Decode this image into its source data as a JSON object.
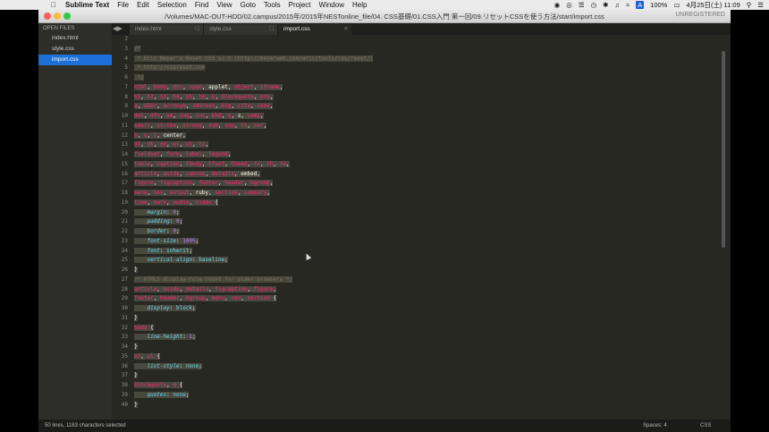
{
  "menubar": {
    "apple_icon": "apple-icon",
    "app_name": "Sublime Text",
    "items": [
      "File",
      "Edit",
      "Selection",
      "Find",
      "View",
      "Goto",
      "Tools",
      "Project",
      "Window",
      "Help"
    ],
    "battery": "100%",
    "clock": "4月25日(土)  11:09",
    "status_icons": [
      "record-icon",
      "eye-icon",
      "menu-icon",
      "clock-icon",
      "bluetooth-icon",
      "volume-icon",
      "wifi-icon",
      "input-method-icon",
      "search-icon",
      "list-icon"
    ]
  },
  "window": {
    "title": "/Volumes/MAC-OUT-HDD/02.campus/2015年/2015年NESTonline_file/04. CSS基礎/01.CSS入門 第一回/09.リセットCSSを使う方法/start/import.css",
    "unregistered": "UNREGISTERED"
  },
  "sidebar": {
    "header": "OPEN FILES",
    "files": [
      {
        "name": "index.html",
        "active": false
      },
      {
        "name": "style.css",
        "active": false
      },
      {
        "name": "import.css",
        "active": true
      }
    ]
  },
  "tabs": [
    {
      "label": "index.html",
      "active": false
    },
    {
      "label": "style.css",
      "active": false
    },
    {
      "label": "import.css",
      "active": true
    }
  ],
  "editor": {
    "line_numbers": [
      "2",
      "3",
      "4",
      "5",
      "6",
      "7",
      "8",
      "9",
      "10",
      "11",
      "12",
      "13",
      "14",
      "15",
      "16",
      "17",
      "18",
      "19",
      "20",
      "21",
      "22",
      "23",
      "24",
      "25",
      "26",
      "27",
      "28",
      "29",
      "30",
      "31",
      "32",
      "33",
      "34",
      "35",
      "36",
      "37",
      "38",
      "39",
      "40"
    ],
    "lines": [
      [],
      [
        [
          "/*",
          "com"
        ]
      ],
      [
        [
          " * Eric Meyer's Reset CSS v2.0 (http://meyerweb.com/eric/tools/css/reset/)",
          "com"
        ]
      ],
      [
        [
          " * http://cssreset.com",
          "com"
        ]
      ],
      [
        [
          " */",
          "com"
        ]
      ],
      [
        [
          "html",
          "tag"
        ],
        [
          ", ",
          "w"
        ],
        [
          "body",
          "tag"
        ],
        [
          ", ",
          "w"
        ],
        [
          "div",
          "tag"
        ],
        [
          ", ",
          "w"
        ],
        [
          "span",
          "tag"
        ],
        [
          ", applet, ",
          "w"
        ],
        [
          "object",
          "tag"
        ],
        [
          ", ",
          "w"
        ],
        [
          "iframe",
          "tag"
        ],
        [
          ",",
          "w"
        ]
      ],
      [
        [
          "h1",
          "tag"
        ],
        [
          ", ",
          "w"
        ],
        [
          "h2",
          "tag"
        ],
        [
          ", ",
          "w"
        ],
        [
          "h3",
          "tag"
        ],
        [
          ", ",
          "w"
        ],
        [
          "h4",
          "tag"
        ],
        [
          ", ",
          "w"
        ],
        [
          "h5",
          "tag"
        ],
        [
          ", ",
          "w"
        ],
        [
          "h6",
          "tag"
        ],
        [
          ", ",
          "w"
        ],
        [
          "p",
          "tag"
        ],
        [
          ", ",
          "w"
        ],
        [
          "blockquote",
          "tag"
        ],
        [
          ", ",
          "w"
        ],
        [
          "pre",
          "tag"
        ],
        [
          ",",
          "w"
        ]
      ],
      [
        [
          "a",
          "tag"
        ],
        [
          ", ",
          "w"
        ],
        [
          "abbr",
          "tag"
        ],
        [
          ", ",
          "w"
        ],
        [
          "acronym",
          "tag"
        ],
        [
          ", ",
          "w"
        ],
        [
          "address",
          "tag"
        ],
        [
          ", ",
          "w"
        ],
        [
          "big",
          "tag"
        ],
        [
          ", ",
          "w"
        ],
        [
          "cite",
          "tag"
        ],
        [
          ", ",
          "w"
        ],
        [
          "code",
          "tag"
        ],
        [
          ",",
          "w"
        ]
      ],
      [
        [
          "del",
          "tag"
        ],
        [
          ", ",
          "w"
        ],
        [
          "dfn",
          "tag"
        ],
        [
          ", ",
          "w"
        ],
        [
          "em",
          "tag"
        ],
        [
          ", ",
          "w"
        ],
        [
          "img",
          "tag"
        ],
        [
          ", ",
          "w"
        ],
        [
          "ins",
          "tag"
        ],
        [
          ", ",
          "w"
        ],
        [
          "kbd",
          "tag"
        ],
        [
          ", ",
          "w"
        ],
        [
          "q",
          "tag"
        ],
        [
          ", s, ",
          "w"
        ],
        [
          "samp",
          "tag"
        ],
        [
          ",",
          "w"
        ]
      ],
      [
        [
          "small",
          "tag"
        ],
        [
          ", ",
          "w"
        ],
        [
          "strike",
          "tag"
        ],
        [
          ", ",
          "w"
        ],
        [
          "strong",
          "tag"
        ],
        [
          ", ",
          "w"
        ],
        [
          "sub",
          "tag"
        ],
        [
          ", ",
          "w"
        ],
        [
          "sup",
          "tag"
        ],
        [
          ", ",
          "w"
        ],
        [
          "tt",
          "tag"
        ],
        [
          ", ",
          "w"
        ],
        [
          "var",
          "tag"
        ],
        [
          ",",
          "w"
        ]
      ],
      [
        [
          "b",
          "tag"
        ],
        [
          ", ",
          "w"
        ],
        [
          "u",
          "tag"
        ],
        [
          ", ",
          "w"
        ],
        [
          "i",
          "tag"
        ],
        [
          ", center,",
          "w"
        ]
      ],
      [
        [
          "dl",
          "tag"
        ],
        [
          ", ",
          "w"
        ],
        [
          "dt",
          "tag"
        ],
        [
          ", ",
          "w"
        ],
        [
          "dd",
          "tag"
        ],
        [
          ", ",
          "w"
        ],
        [
          "ol",
          "tag"
        ],
        [
          ", ",
          "w"
        ],
        [
          "ul",
          "tag"
        ],
        [
          ", ",
          "w"
        ],
        [
          "li",
          "tag"
        ],
        [
          ",",
          "w"
        ]
      ],
      [
        [
          "fieldset",
          "tag"
        ],
        [
          ", ",
          "w"
        ],
        [
          "form",
          "tag"
        ],
        [
          ", ",
          "w"
        ],
        [
          "label",
          "tag"
        ],
        [
          ", ",
          "w"
        ],
        [
          "legend",
          "tag"
        ],
        [
          ",",
          "w"
        ]
      ],
      [
        [
          "table",
          "tag"
        ],
        [
          ", ",
          "w"
        ],
        [
          "caption",
          "tag"
        ],
        [
          ", ",
          "w"
        ],
        [
          "tbody",
          "tag"
        ],
        [
          ", ",
          "w"
        ],
        [
          "tfoot",
          "tag"
        ],
        [
          ", ",
          "w"
        ],
        [
          "thead",
          "tag"
        ],
        [
          ", ",
          "w"
        ],
        [
          "tr",
          "tag"
        ],
        [
          ", ",
          "w"
        ],
        [
          "th",
          "tag"
        ],
        [
          ", ",
          "w"
        ],
        [
          "td",
          "tag"
        ],
        [
          ",",
          "w"
        ]
      ],
      [
        [
          "article",
          "tag"
        ],
        [
          ", ",
          "w"
        ],
        [
          "aside",
          "tag"
        ],
        [
          ", ",
          "w"
        ],
        [
          "canvas",
          "tag"
        ],
        [
          ", ",
          "w"
        ],
        [
          "details",
          "tag"
        ],
        [
          ", embed,",
          "w"
        ]
      ],
      [
        [
          "figure",
          "tag"
        ],
        [
          ", ",
          "w"
        ],
        [
          "figcaption",
          "tag"
        ],
        [
          ", ",
          "w"
        ],
        [
          "footer",
          "tag"
        ],
        [
          ", ",
          "w"
        ],
        [
          "header",
          "tag"
        ],
        [
          ", ",
          "w"
        ],
        [
          "hgroup",
          "tag"
        ],
        [
          ",",
          "w"
        ]
      ],
      [
        [
          "menu",
          "tag"
        ],
        [
          ", ",
          "w"
        ],
        [
          "nav",
          "tag"
        ],
        [
          ", ",
          "w"
        ],
        [
          "output",
          "tag"
        ],
        [
          ", ruby, ",
          "w"
        ],
        [
          "section",
          "tag"
        ],
        [
          ", ",
          "w"
        ],
        [
          "summary",
          "tag"
        ],
        [
          ",",
          "w"
        ]
      ],
      [
        [
          "time",
          "tag"
        ],
        [
          ", ",
          "w"
        ],
        [
          "mark",
          "tag"
        ],
        [
          ", ",
          "w"
        ],
        [
          "audio",
          "tag"
        ],
        [
          ", ",
          "w"
        ],
        [
          "video",
          "tag"
        ],
        [
          " {",
          "w"
        ]
      ],
      [
        [
          "····",
          "ind"
        ],
        [
          "margin",
          "prop"
        ],
        [
          ": ",
          "w"
        ],
        [
          "0",
          "num"
        ],
        [
          ";",
          "w"
        ]
      ],
      [
        [
          "····",
          "ind"
        ],
        [
          "padding",
          "prop"
        ],
        [
          ": ",
          "w"
        ],
        [
          "0",
          "num"
        ],
        [
          ";",
          "w"
        ]
      ],
      [
        [
          "····",
          "ind"
        ],
        [
          "border",
          "prop"
        ],
        [
          ": ",
          "w"
        ],
        [
          "0",
          "num"
        ],
        [
          ";",
          "w"
        ]
      ],
      [
        [
          "····",
          "ind"
        ],
        [
          "font-size",
          "prop"
        ],
        [
          ": ",
          "w"
        ],
        [
          "100%",
          "num"
        ],
        [
          ";",
          "w"
        ]
      ],
      [
        [
          "····",
          "ind"
        ],
        [
          "font",
          "prop"
        ],
        [
          ": ",
          "w"
        ],
        [
          "inherit",
          "val"
        ],
        [
          ";",
          "w"
        ]
      ],
      [
        [
          "····",
          "ind"
        ],
        [
          "vertical-align",
          "prop"
        ],
        [
          ": ",
          "w"
        ],
        [
          "baseline",
          "val"
        ],
        [
          ";",
          "w"
        ]
      ],
      [
        [
          "}",
          "w"
        ]
      ],
      [
        [
          "/* HTML5 display-role reset for older browsers */",
          "com"
        ]
      ],
      [
        [
          "article",
          "tag"
        ],
        [
          ", ",
          "w"
        ],
        [
          "aside",
          "tag"
        ],
        [
          ", ",
          "w"
        ],
        [
          "details",
          "tag"
        ],
        [
          ", ",
          "w"
        ],
        [
          "figcaption",
          "tag"
        ],
        [
          ", ",
          "w"
        ],
        [
          "figure",
          "tag"
        ],
        [
          ",",
          "w"
        ]
      ],
      [
        [
          "footer",
          "tag"
        ],
        [
          ", ",
          "w"
        ],
        [
          "header",
          "tag"
        ],
        [
          ", ",
          "w"
        ],
        [
          "hgroup",
          "tag"
        ],
        [
          ", ",
          "w"
        ],
        [
          "menu",
          "tag"
        ],
        [
          ", ",
          "w"
        ],
        [
          "nav",
          "tag"
        ],
        [
          ", ",
          "w"
        ],
        [
          "section",
          "tag"
        ],
        [
          " {",
          "w"
        ]
      ],
      [
        [
          "····",
          "ind"
        ],
        [
          "display",
          "prop"
        ],
        [
          ": ",
          "w"
        ],
        [
          "block",
          "val"
        ],
        [
          ";",
          "w"
        ]
      ],
      [
        [
          "}",
          "w"
        ]
      ],
      [
        [
          "body",
          "tag"
        ],
        [
          " {",
          "w"
        ]
      ],
      [
        [
          "····",
          "ind"
        ],
        [
          "line-height",
          "prop"
        ],
        [
          ": ",
          "w"
        ],
        [
          "1",
          "num"
        ],
        [
          ";",
          "w"
        ]
      ],
      [
        [
          "}",
          "w"
        ]
      ],
      [
        [
          "ol",
          "tag"
        ],
        [
          ", ",
          "w"
        ],
        [
          "ul",
          "tag"
        ],
        [
          " {",
          "w"
        ]
      ],
      [
        [
          "····",
          "ind"
        ],
        [
          "list-style",
          "prop"
        ],
        [
          ": ",
          "w"
        ],
        [
          "none",
          "val"
        ],
        [
          ";",
          "w"
        ]
      ],
      [
        [
          "}",
          "w"
        ]
      ],
      [
        [
          "blockquote",
          "tag"
        ],
        [
          ", ",
          "w"
        ],
        [
          "q",
          "tag"
        ],
        [
          " {",
          "w"
        ]
      ],
      [
        [
          "····",
          "ind"
        ],
        [
          "quotes",
          "prop"
        ],
        [
          ": ",
          "w"
        ],
        [
          "none",
          "val"
        ],
        [
          ";",
          "w"
        ]
      ],
      [
        [
          "}",
          "w"
        ]
      ]
    ]
  },
  "statusbar": {
    "selection": "50 lines, 1183 characters selected",
    "spaces": "Spaces: 4",
    "syntax": "CSS"
  }
}
